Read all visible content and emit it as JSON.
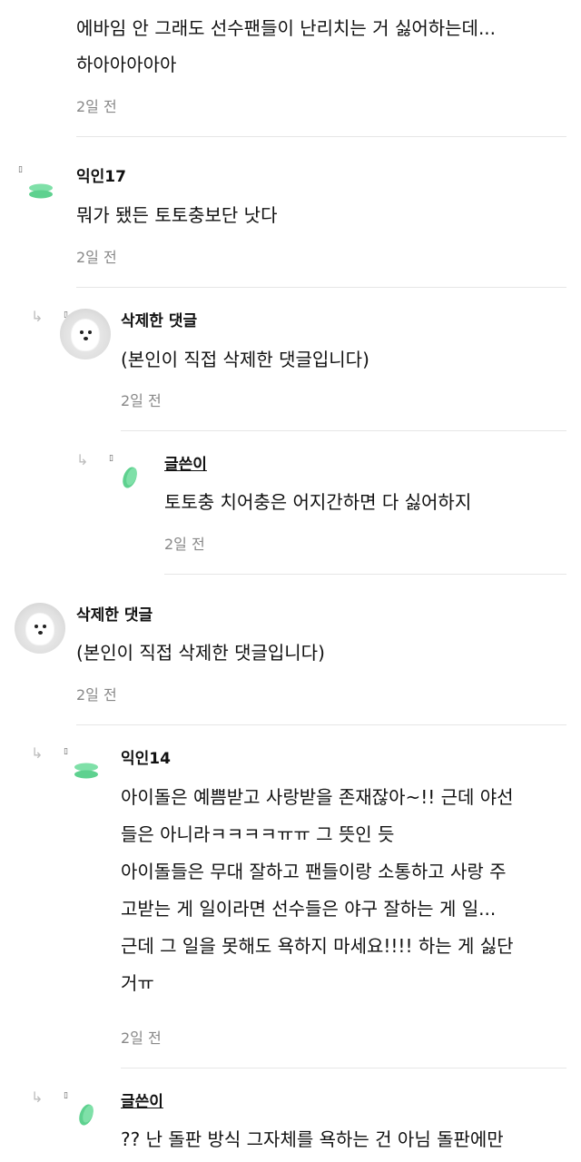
{
  "top_comment": {
    "lines": [
      "에바임 안 그래도 선수팬들이 난리치는 거 싫어하는데...",
      "하아아아아아"
    ],
    "time": "2일 전"
  },
  "comments": [
    {
      "name": "익인17",
      "lines": [
        "뭐가 됐든 토토충보단 낫다"
      ],
      "time": "2일 전",
      "avatar_icon": "green-disc-icon"
    },
    {
      "name": "삭제한 댓글",
      "lines": [
        "(본인이 직접 삭제한 댓글입니다)"
      ],
      "time": "2일 전",
      "avatar_icon": "dog-avatar"
    },
    {
      "name": "글쓴이",
      "lines": [
        "토토충 치어충은 어지간하면 다 싫어하지"
      ],
      "time": "2일 전",
      "avatar_icon": "green-disc-icon"
    },
    {
      "name": "삭제한 댓글",
      "lines": [
        "(본인이 직접 삭제한 댓글입니다)"
      ],
      "time": "2일 전",
      "avatar_icon": "dog-avatar"
    },
    {
      "name": "익인14",
      "lines": [
        "아이돌은 예쁨받고 사랑받을 존재잖아~!! 근데 야선",
        "들은 아니라ㅋㅋㅋㅋㅠㅠ 그 뜻인 듯",
        "아이돌들은 무대 잘하고 팬들이랑 소통하고 사랑 주",
        "고받는 게 일이라면 선수들은 야구 잘하는 게 일...",
        "근데 그 일을 못해도 욕하지 마세요!!!! 하는 게 싫단",
        "거ㅠ"
      ],
      "time": "2일 전",
      "avatar_icon": "green-disc-icon"
    },
    {
      "name": "글쓴이",
      "lines": [
        "?? 난 돌판 방식 그자체를 욕하는 건 아님 돌판에만"
      ],
      "avatar_icon": "green-disc-icon"
    }
  ],
  "icons": {
    "reply": "reply-arrow-icon",
    "reply_glyph": "↳",
    "tiny_glyph": "▯"
  },
  "colors": {
    "accent_green": "#5ed18f",
    "divider": "#e6e6e6",
    "meta": "#888888"
  }
}
